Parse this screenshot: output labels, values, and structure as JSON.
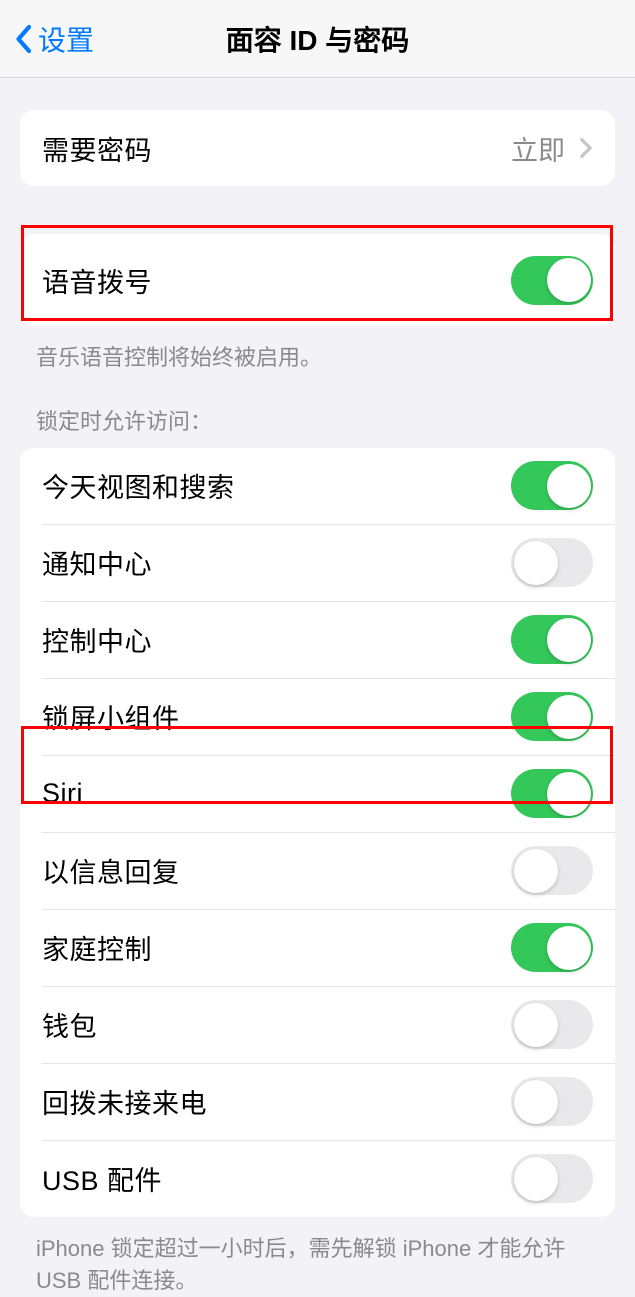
{
  "nav": {
    "back_label": "设置",
    "title": "面容 ID 与密码"
  },
  "group1": {
    "require_passcode": {
      "label": "需要密码",
      "value": "立即"
    }
  },
  "group2": {
    "voice_dial": {
      "label": "语音拨号",
      "on": true
    },
    "footer": "音乐语音控制将始终被启用。"
  },
  "group3": {
    "header": "锁定时允许访问：",
    "today": {
      "label": "今天视图和搜索",
      "on": true
    },
    "notification_center": {
      "label": "通知中心",
      "on": false
    },
    "control_center": {
      "label": "控制中心",
      "on": true
    },
    "lock_widgets": {
      "label": "锁屏小组件",
      "on": true
    },
    "siri": {
      "label": "Siri",
      "on": true
    },
    "reply_message": {
      "label": "以信息回复",
      "on": false
    },
    "home_control": {
      "label": "家庭控制",
      "on": true
    },
    "wallet": {
      "label": "钱包",
      "on": false
    },
    "return_missed": {
      "label": "回拨未接来电",
      "on": false
    },
    "usb": {
      "label": "USB 配件",
      "on": false
    },
    "footer": "iPhone 锁定超过一小时后，需先解锁 iPhone 才能允许 USB 配件连接。"
  }
}
